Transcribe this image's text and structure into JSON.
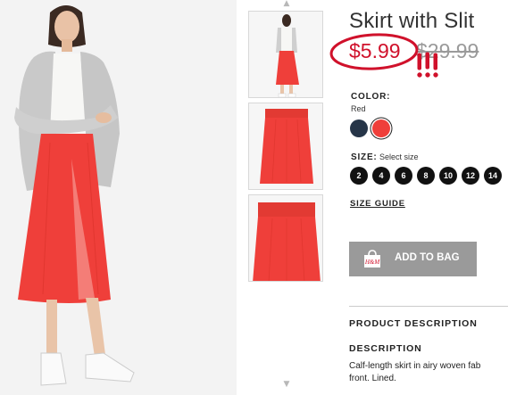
{
  "product": {
    "title": "Skirt with Slit",
    "price": "$5.99",
    "original_price": "$29.99",
    "annotation_marks": "!!!"
  },
  "color": {
    "label": "COLOR:",
    "selected": "Red",
    "swatches": [
      {
        "name": "navy",
        "hex": "#263548"
      },
      {
        "name": "red",
        "hex": "#ef3f3a"
      }
    ]
  },
  "size": {
    "label": "SIZE:",
    "hint": "Select size",
    "options": [
      "2",
      "4",
      "6",
      "8",
      "10",
      "12",
      "14"
    ]
  },
  "size_guide": "SIZE GUIDE",
  "add_to_bag": {
    "label": "ADD TO BAG",
    "brand_icon_text": "H&M",
    "bg_color": "#9a9a9a"
  },
  "details": {
    "product_description_heading": "PRODUCT DESCRIPTION",
    "description_heading": "DESCRIPTION",
    "description_line1": "Calf-length skirt in airy woven fab",
    "description_line2": "front. Lined."
  },
  "colors": {
    "accent_red": "#d0112b",
    "skirt_red": "#ef3f3a"
  }
}
